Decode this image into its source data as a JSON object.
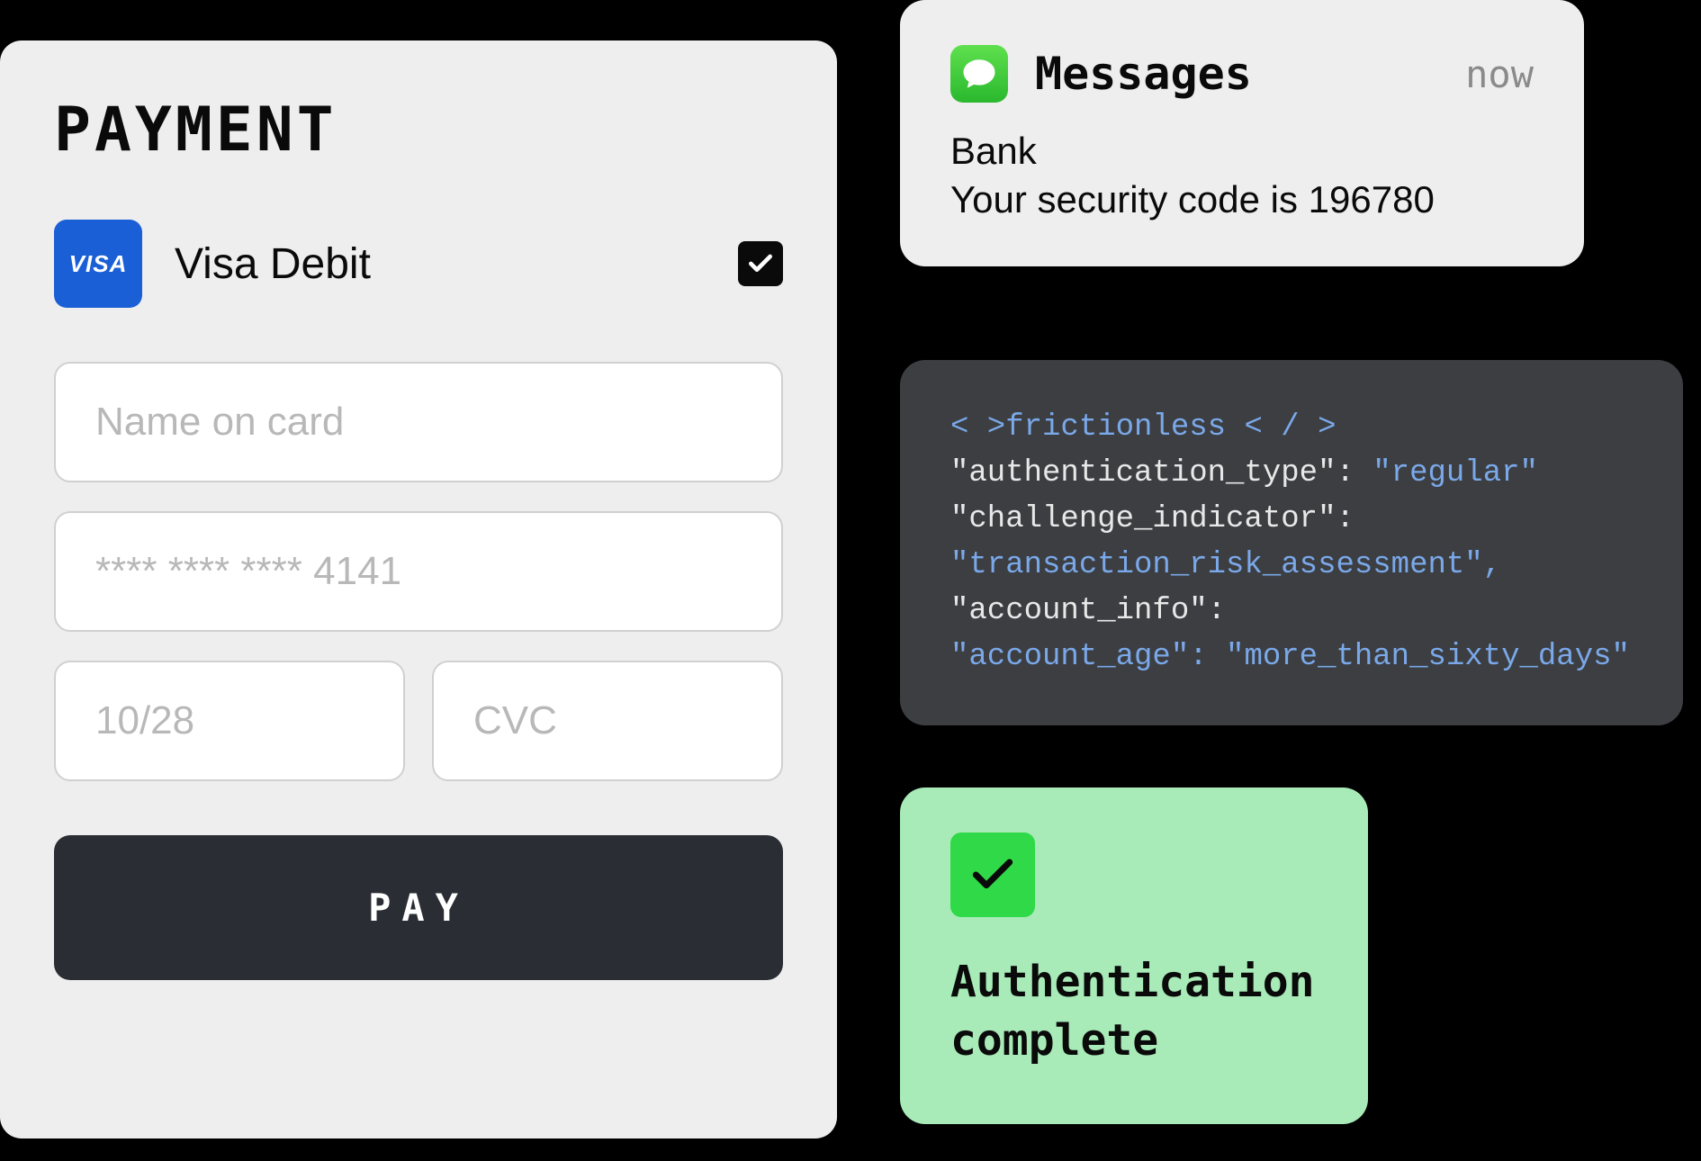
{
  "payment": {
    "title": "PAYMENT",
    "card_brand": "VISA",
    "card_label": "Visa Debit",
    "selected": true,
    "fields": {
      "name_placeholder": "Name on card",
      "number_placeholder": "**** **** **** 4141",
      "expiry_placeholder": "10/28",
      "cvc_placeholder": "CVC"
    },
    "button_label": "PAY"
  },
  "notification": {
    "app": "Messages",
    "time": "now",
    "sender": "Bank",
    "body": "Your security code is 196780"
  },
  "code": {
    "line1_open": "< >",
    "line1_tag": "frictionless",
    "line1_close": " < / >",
    "line2_key": "\"authentication_type\": ",
    "line2_val": "\"regular\"",
    "line3_key": "\"challenge_indicator\":",
    "line4_val": "\"transaction_risk_assessment\",",
    "line5_key": "\"account_info\":",
    "line6_val": "\"account_age\": \"more_than_sixty_days\""
  },
  "auth": {
    "status": "Authentication complete"
  }
}
